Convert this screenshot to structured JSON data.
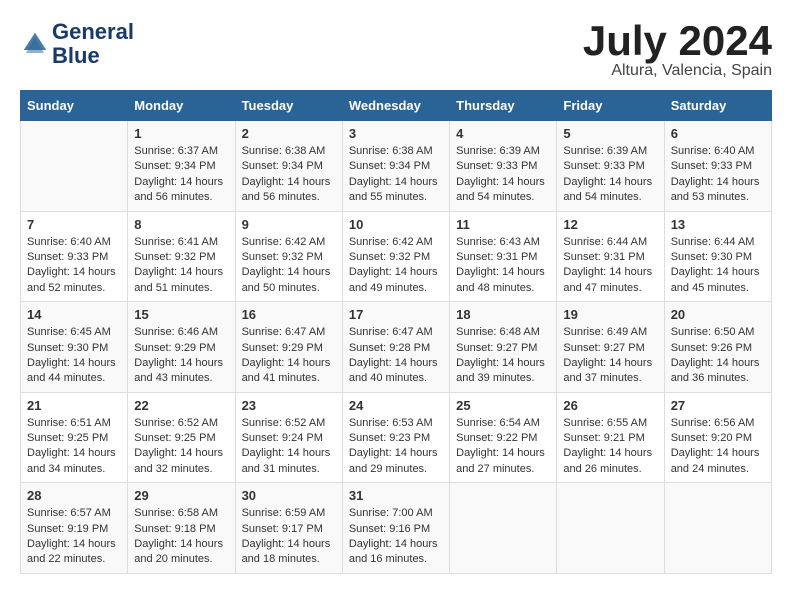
{
  "header": {
    "logo_line1": "General",
    "logo_line2": "Blue",
    "month": "July 2024",
    "location": "Altura, Valencia, Spain"
  },
  "days_of_week": [
    "Sunday",
    "Monday",
    "Tuesday",
    "Wednesday",
    "Thursday",
    "Friday",
    "Saturday"
  ],
  "weeks": [
    [
      {
        "day": "",
        "content": ""
      },
      {
        "day": "1",
        "content": "Sunrise: 6:37 AM\nSunset: 9:34 PM\nDaylight: 14 hours\nand 56 minutes."
      },
      {
        "day": "2",
        "content": "Sunrise: 6:38 AM\nSunset: 9:34 PM\nDaylight: 14 hours\nand 56 minutes."
      },
      {
        "day": "3",
        "content": "Sunrise: 6:38 AM\nSunset: 9:34 PM\nDaylight: 14 hours\nand 55 minutes."
      },
      {
        "day": "4",
        "content": "Sunrise: 6:39 AM\nSunset: 9:33 PM\nDaylight: 14 hours\nand 54 minutes."
      },
      {
        "day": "5",
        "content": "Sunrise: 6:39 AM\nSunset: 9:33 PM\nDaylight: 14 hours\nand 54 minutes."
      },
      {
        "day": "6",
        "content": "Sunrise: 6:40 AM\nSunset: 9:33 PM\nDaylight: 14 hours\nand 53 minutes."
      }
    ],
    [
      {
        "day": "7",
        "content": "Sunrise: 6:40 AM\nSunset: 9:33 PM\nDaylight: 14 hours\nand 52 minutes."
      },
      {
        "day": "8",
        "content": "Sunrise: 6:41 AM\nSunset: 9:32 PM\nDaylight: 14 hours\nand 51 minutes."
      },
      {
        "day": "9",
        "content": "Sunrise: 6:42 AM\nSunset: 9:32 PM\nDaylight: 14 hours\nand 50 minutes."
      },
      {
        "day": "10",
        "content": "Sunrise: 6:42 AM\nSunset: 9:32 PM\nDaylight: 14 hours\nand 49 minutes."
      },
      {
        "day": "11",
        "content": "Sunrise: 6:43 AM\nSunset: 9:31 PM\nDaylight: 14 hours\nand 48 minutes."
      },
      {
        "day": "12",
        "content": "Sunrise: 6:44 AM\nSunset: 9:31 PM\nDaylight: 14 hours\nand 47 minutes."
      },
      {
        "day": "13",
        "content": "Sunrise: 6:44 AM\nSunset: 9:30 PM\nDaylight: 14 hours\nand 45 minutes."
      }
    ],
    [
      {
        "day": "14",
        "content": "Sunrise: 6:45 AM\nSunset: 9:30 PM\nDaylight: 14 hours\nand 44 minutes."
      },
      {
        "day": "15",
        "content": "Sunrise: 6:46 AM\nSunset: 9:29 PM\nDaylight: 14 hours\nand 43 minutes."
      },
      {
        "day": "16",
        "content": "Sunrise: 6:47 AM\nSunset: 9:29 PM\nDaylight: 14 hours\nand 41 minutes."
      },
      {
        "day": "17",
        "content": "Sunrise: 6:47 AM\nSunset: 9:28 PM\nDaylight: 14 hours\nand 40 minutes."
      },
      {
        "day": "18",
        "content": "Sunrise: 6:48 AM\nSunset: 9:27 PM\nDaylight: 14 hours\nand 39 minutes."
      },
      {
        "day": "19",
        "content": "Sunrise: 6:49 AM\nSunset: 9:27 PM\nDaylight: 14 hours\nand 37 minutes."
      },
      {
        "day": "20",
        "content": "Sunrise: 6:50 AM\nSunset: 9:26 PM\nDaylight: 14 hours\nand 36 minutes."
      }
    ],
    [
      {
        "day": "21",
        "content": "Sunrise: 6:51 AM\nSunset: 9:25 PM\nDaylight: 14 hours\nand 34 minutes."
      },
      {
        "day": "22",
        "content": "Sunrise: 6:52 AM\nSunset: 9:25 PM\nDaylight: 14 hours\nand 32 minutes."
      },
      {
        "day": "23",
        "content": "Sunrise: 6:52 AM\nSunset: 9:24 PM\nDaylight: 14 hours\nand 31 minutes."
      },
      {
        "day": "24",
        "content": "Sunrise: 6:53 AM\nSunset: 9:23 PM\nDaylight: 14 hours\nand 29 minutes."
      },
      {
        "day": "25",
        "content": "Sunrise: 6:54 AM\nSunset: 9:22 PM\nDaylight: 14 hours\nand 27 minutes."
      },
      {
        "day": "26",
        "content": "Sunrise: 6:55 AM\nSunset: 9:21 PM\nDaylight: 14 hours\nand 26 minutes."
      },
      {
        "day": "27",
        "content": "Sunrise: 6:56 AM\nSunset: 9:20 PM\nDaylight: 14 hours\nand 24 minutes."
      }
    ],
    [
      {
        "day": "28",
        "content": "Sunrise: 6:57 AM\nSunset: 9:19 PM\nDaylight: 14 hours\nand 22 minutes."
      },
      {
        "day": "29",
        "content": "Sunrise: 6:58 AM\nSunset: 9:18 PM\nDaylight: 14 hours\nand 20 minutes."
      },
      {
        "day": "30",
        "content": "Sunrise: 6:59 AM\nSunset: 9:17 PM\nDaylight: 14 hours\nand 18 minutes."
      },
      {
        "day": "31",
        "content": "Sunrise: 7:00 AM\nSunset: 9:16 PM\nDaylight: 14 hours\nand 16 minutes."
      },
      {
        "day": "",
        "content": ""
      },
      {
        "day": "",
        "content": ""
      },
      {
        "day": "",
        "content": ""
      }
    ]
  ]
}
